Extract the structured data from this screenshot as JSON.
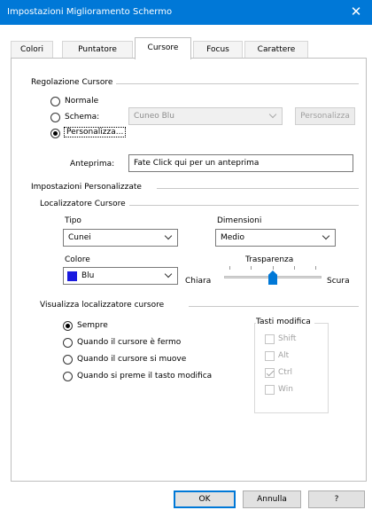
{
  "window": {
    "title": "Impostazioni Miglioramento Schermo",
    "close_glyph": "✕"
  },
  "tabs": [
    {
      "label": "Colori"
    },
    {
      "label": "Puntatore"
    },
    {
      "label": "Cursore",
      "active": true
    },
    {
      "label": "Focus"
    },
    {
      "label": "Carattere"
    }
  ],
  "regolazione": {
    "group_label": "Regolazione Cursore",
    "normale_label": "Normale",
    "schema_label": "Schema:",
    "schema_value": "Cuneo Blu",
    "personalizza_radio_label": "Personalizza...",
    "personalizza_button_label": "Personalizza",
    "selected": "personalizza"
  },
  "anteprima": {
    "label": "Anteprima:",
    "value": "Fate Click qui per un anteprima"
  },
  "personalizzate": {
    "group_label": "Impostazioni Personalizzate",
    "localizzatore": {
      "group_label": "Localizzatore Cursore",
      "tipo_label": "Tipo",
      "tipo_value": "Cunei",
      "dimensioni_label": "Dimensioni",
      "dimensioni_value": "Medio",
      "colore_label": "Colore",
      "colore_value": "Blu",
      "colore_hex": "#1a1adf",
      "trasparenza_label": "Trasparenza",
      "chiara_label": "Chiara",
      "scura_label": "Scura",
      "trasparenza_level": 0.5
    },
    "visualizza": {
      "group_label": "Visualizza localizzatore cursore",
      "options": [
        {
          "label": "Sempre",
          "checked": true
        },
        {
          "label": "Quando il cursore è fermo",
          "checked": false
        },
        {
          "label": "Quando il cursore si muove",
          "checked": false
        },
        {
          "label": "Quando si preme il tasto modifica",
          "checked": false
        }
      ]
    },
    "tasti_modifica": {
      "label": "Tasti modifica",
      "keys": [
        {
          "label": "Shift",
          "checked": false
        },
        {
          "label": "Alt",
          "checked": false
        },
        {
          "label": "Ctrl",
          "checked": true
        },
        {
          "label": "Win",
          "checked": false
        }
      ]
    }
  },
  "footer": {
    "ok_label": "OK",
    "annulla_label": "Annulla",
    "help_label": "?"
  },
  "colors": {
    "titlebar": "#0078d7",
    "accent": "#0078d7"
  }
}
